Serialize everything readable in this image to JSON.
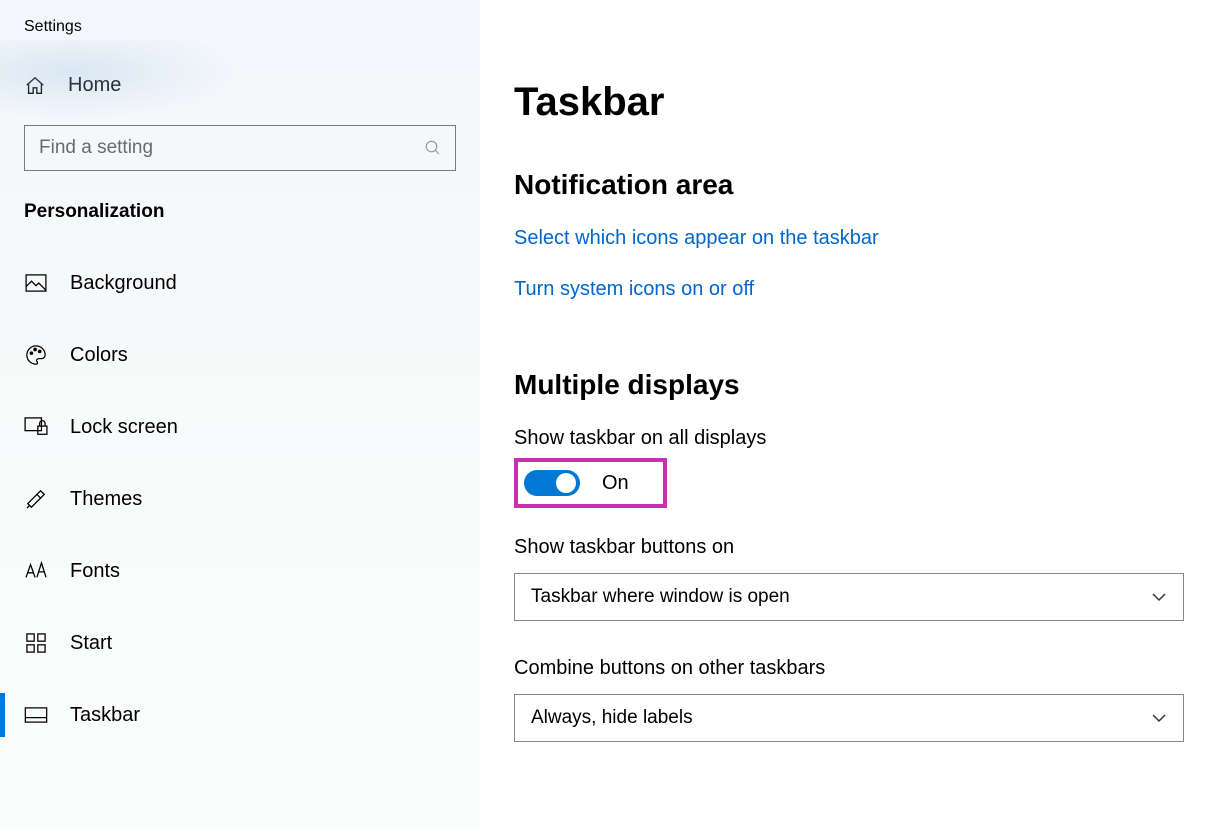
{
  "app": {
    "title": "Settings"
  },
  "sidebar": {
    "home": "Home",
    "search_placeholder": "Find a setting",
    "category": "Personalization",
    "items": [
      {
        "label": "Background",
        "icon": "image-icon"
      },
      {
        "label": "Colors",
        "icon": "palette-icon"
      },
      {
        "label": "Lock screen",
        "icon": "lock-screen-icon"
      },
      {
        "label": "Themes",
        "icon": "paintbrush-icon"
      },
      {
        "label": "Fonts",
        "icon": "font-icon"
      },
      {
        "label": "Start",
        "icon": "start-grid-icon"
      },
      {
        "label": "Taskbar",
        "icon": "taskbar-icon"
      }
    ],
    "selected_index": 6
  },
  "main": {
    "title": "Taskbar",
    "notification_section": {
      "title": "Notification area",
      "link1": "Select which icons appear on the taskbar",
      "link2": "Turn system icons on or off"
    },
    "multiple_displays_section": {
      "title": "Multiple displays",
      "show_all_label": "Show taskbar on all displays",
      "show_all_state": "On",
      "show_buttons_label": "Show taskbar buttons on",
      "show_buttons_value": "Taskbar where window is open",
      "combine_label": "Combine buttons on other taskbars",
      "combine_value": "Always, hide labels"
    }
  }
}
